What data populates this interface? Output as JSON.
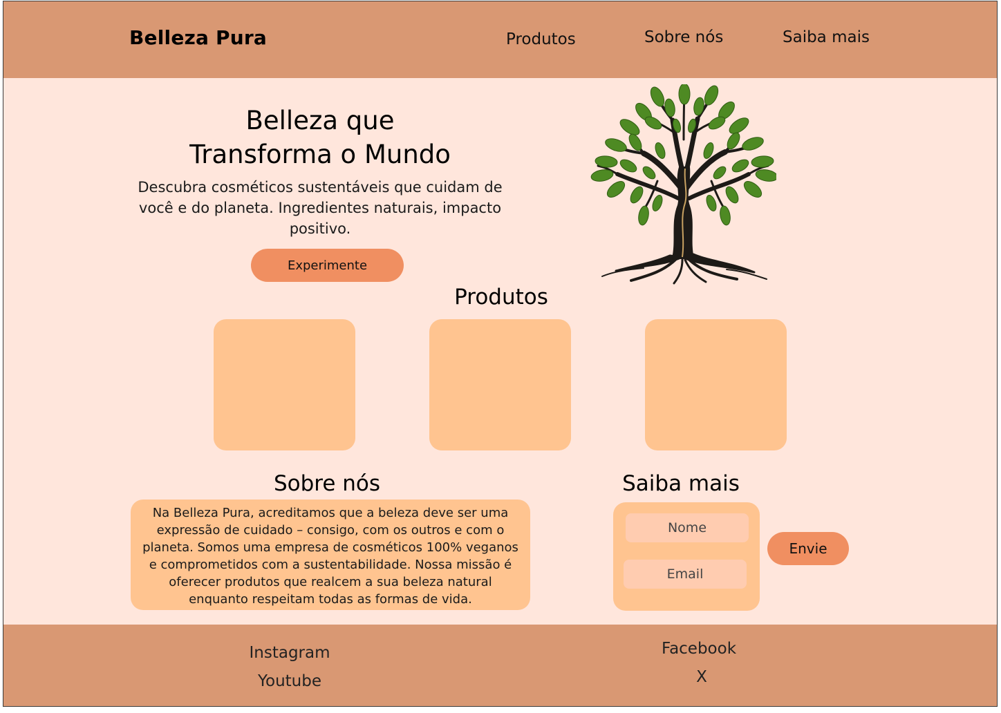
{
  "header": {
    "brand": "Belleza Pura",
    "nav": [
      "Produtos",
      "Sobre nós",
      "Saiba mais"
    ]
  },
  "hero": {
    "title_line1": "Belleza que",
    "title_line2": "Transforma o Mundo",
    "subtitle": "Descubra cosméticos sustentáveis que cuidam de você e do planeta. Ingredientes naturais, impacto positivo.",
    "cta": "Experimente"
  },
  "products": {
    "title": "Produtos",
    "cards": [
      "",
      "",
      ""
    ]
  },
  "about": {
    "title": "Sobre nós",
    "text": "Na Belleza Pura, acreditamos que a beleza deve ser uma expressão de cuidado – consigo, com os outros e com o planeta. Somos uma empresa de cosméticos 100% veganos e comprometidos com a sustentabilidade. Nossa missão é oferecer produtos que realcem a sua beleza natural enquanto respeitam todas as formas de vida."
  },
  "contact": {
    "title": "Saiba mais",
    "name_placeholder": "Nome",
    "email_placeholder": "Email",
    "submit": "Envie"
  },
  "footer": {
    "links": [
      "Instagram",
      "Youtube",
      "Facebook",
      "X"
    ]
  },
  "colors": {
    "header_bg": "#d99873",
    "page_bg": "#ffe6dc",
    "card_bg": "#ffc490",
    "button_bg": "#f08f61",
    "field_bg": "#ffccb0",
    "leaf": "#4e8a23",
    "trunk": "#1d1a17"
  },
  "icons": {
    "hero_image": "tree-illustration"
  }
}
